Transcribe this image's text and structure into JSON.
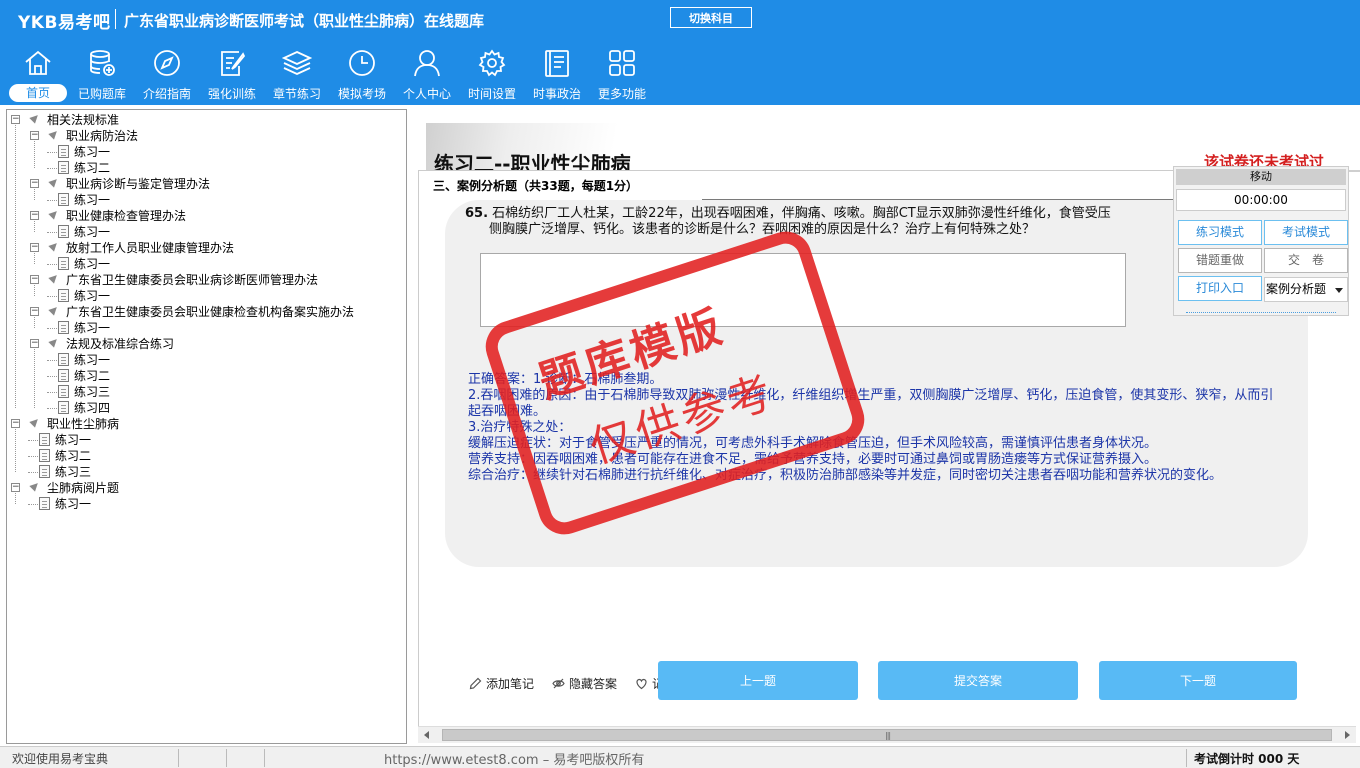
{
  "header": {
    "logo": "YKB易考吧",
    "title": "广东省职业病诊断医师考试（职业性尘肺病）在线题库",
    "switch_label": "切换科目",
    "brand_color": "#1f8ce6"
  },
  "nav": [
    {
      "label": "首页",
      "icon": "home-icon",
      "active": true
    },
    {
      "label": "已购题库",
      "icon": "database-icon"
    },
    {
      "label": "介绍指南",
      "icon": "compass-icon"
    },
    {
      "label": "强化训练",
      "icon": "edit-icon"
    },
    {
      "label": "章节练习",
      "icon": "layers-icon"
    },
    {
      "label": "模拟考场",
      "icon": "clock-icon"
    },
    {
      "label": "个人中心",
      "icon": "user-icon"
    },
    {
      "label": "时间设置",
      "icon": "gear-icon"
    },
    {
      "label": "时事政治",
      "icon": "news-icon"
    },
    {
      "label": "更多功能",
      "icon": "grid-icon"
    }
  ],
  "tree": [
    {
      "label": "相关法规标准",
      "children": [
        {
          "label": "职业病防治法",
          "children": [
            "练习一",
            "练习二"
          ]
        },
        {
          "label": "职业病诊断与鉴定管理办法",
          "children": [
            "练习一"
          ]
        },
        {
          "label": "职业健康检查管理办法",
          "children": [
            "练习一"
          ]
        },
        {
          "label": "放射工作人员职业健康管理办法",
          "children": [
            "练习一"
          ]
        },
        {
          "label": "广东省卫生健康委员会职业病诊断医师管理办法",
          "children": [
            "练习一"
          ]
        },
        {
          "label": "广东省卫生健康委员会职业健康检查机构备案实施办法",
          "children": [
            "练习一"
          ]
        },
        {
          "label": "法规及标准综合练习",
          "children": [
            "练习一",
            "练习二",
            "练习三",
            "练习四"
          ]
        }
      ]
    },
    {
      "label": "职业性尘肺病",
      "children": [
        "练习一",
        "练习二",
        "练习三"
      ]
    },
    {
      "label": "尘肺病阅片题",
      "children": [
        "练习一"
      ]
    }
  ],
  "paper": {
    "title": "练习二--职业性尘肺病",
    "status": "该试卷还未考试过",
    "section": "三、案例分析题（共33题，每题1分）"
  },
  "question": {
    "number": "65.",
    "line1": "石棉纺织厂工人杜某，工龄22年，出现吞咽困难，伴胸痛、咳嗽。胸部CT显示双肺弥漫性纤维化，食管受压",
    "line2": "侧胸膜广泛增厚、钙化。该患者的诊断是什么？吞咽困难的原因是什么？治疗上有何特殊之处？"
  },
  "answer": {
    "lines": [
      "正确答案：1.诊断：石棉肺叁期。",
      "2.吞咽困难的原因：由于石棉肺导致双肺弥漫性纤维化，纤维组织增生严重，双侧胸膜广泛增厚、钙化，压迫食管，使其变形、狭窄，从而引起吞咽困难。",
      "3.治疗特殊之处：",
      "缓解压迫症状：对于食管受压严重的情况，可考虑外科手术解除食管压迫，但手术风险较高，需谨慎评估患者身体状况。",
      "营养支持：因吞咽困难，患者可能存在进食不足，需给予营养支持，必要时可通过鼻饲或胃肠造瘘等方式保证营养摄入。",
      "综合治疗：继续针对石棉肺进行抗纤维化、对症治疗，积极防治肺部感染等并发症，同时密切关注患者吞咽功能和营养状况的变化。"
    ],
    "color": "#1c35a8"
  },
  "stamp": {
    "line1": "题库模版",
    "line2": "仅供参考",
    "color": "#e22020"
  },
  "tools": {
    "add_note": "添加笔记",
    "hide_answer": "隐藏答案",
    "favorite": "记"
  },
  "buttons": {
    "prev": "上一题",
    "submit": "提交答案",
    "next": "下一题"
  },
  "float_panel": {
    "move": "移动",
    "timer": "00:00:00",
    "practice_mode": "练习模式",
    "exam_mode": "考试模式",
    "redo_wrong": "错题重做",
    "hand_in": "交　卷",
    "print": "打印入口",
    "type_selected": "案例分析题"
  },
  "status_bar": {
    "welcome": "欢迎使用易考宝典",
    "url": "https://www.etest8.com – 易考吧版权所有",
    "countdown": "考试倒计时 000 天"
  }
}
